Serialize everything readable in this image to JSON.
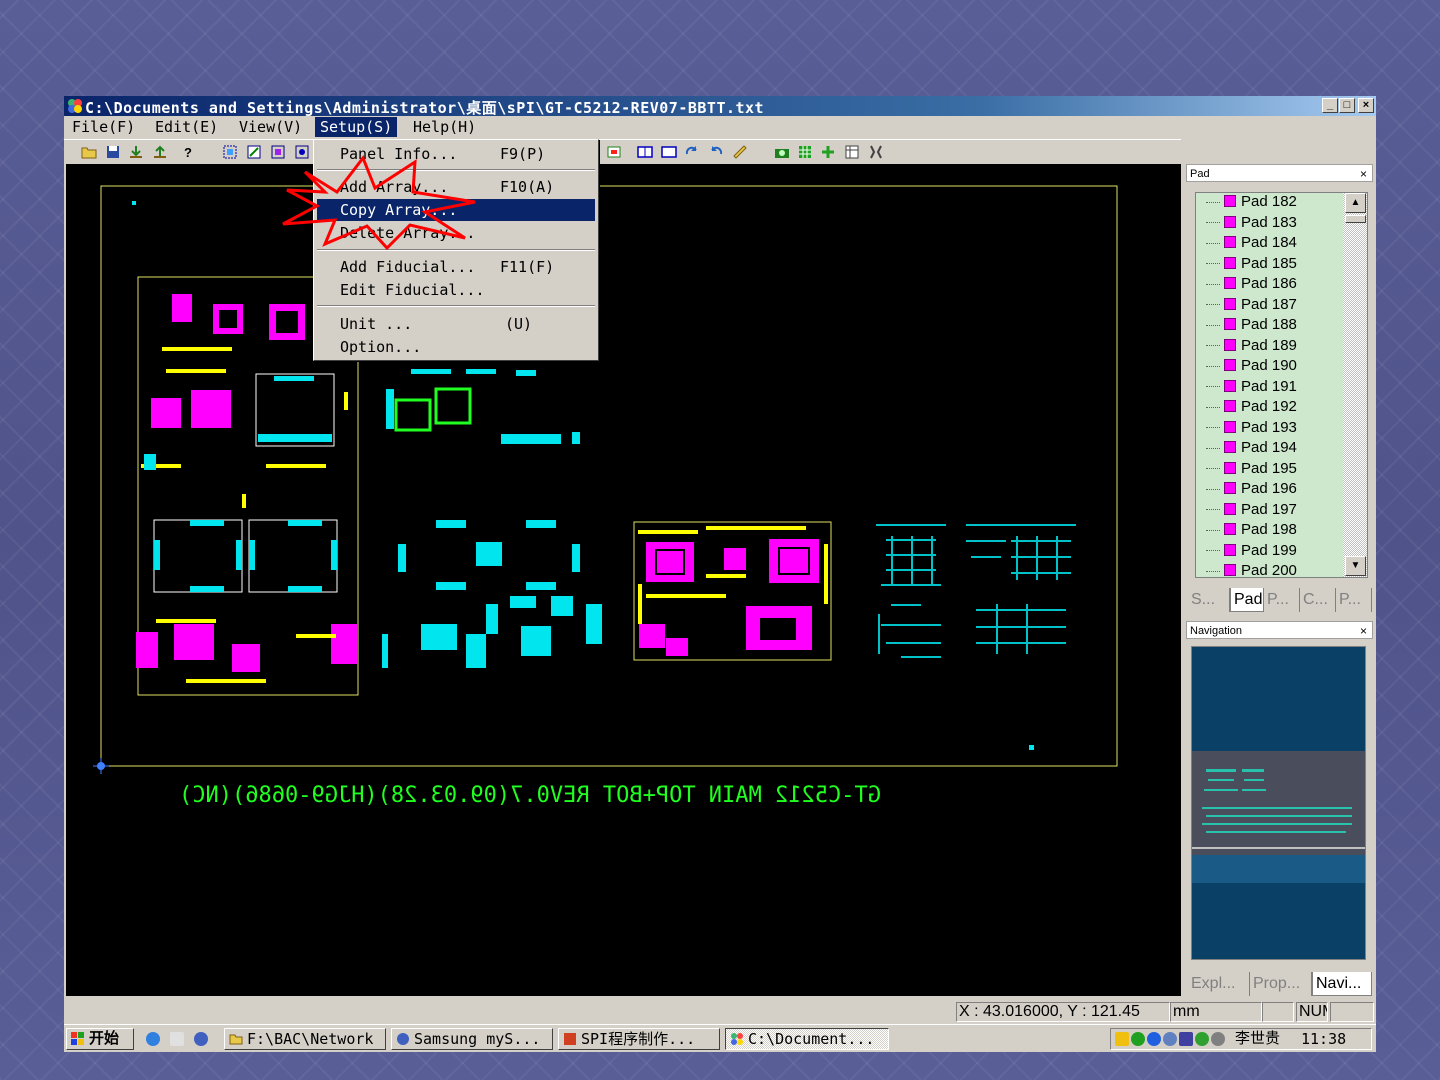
{
  "window": {
    "title": "C:\\Documents and Settings\\Administrator\\桌面\\sPI\\GT-C5212-REV07-BBTT.txt",
    "controls": {
      "minimize": "_",
      "maximize": "□",
      "close": "×"
    }
  },
  "menubar": {
    "file": "File(F)",
    "edit": "Edit(E)",
    "view": "View(V)",
    "setup": "Setup(S)",
    "help": "Help(H)"
  },
  "setup_menu": {
    "items": [
      {
        "label": "Panel Info...",
        "shortcut": "F9(P)"
      },
      {
        "label": "Add Array...",
        "shortcut": "F10(A)"
      },
      {
        "label": "Copy Array...",
        "shortcut": ""
      },
      {
        "label": "Delete Array...",
        "shortcut": ""
      },
      {
        "label": "Add Fiducial...",
        "shortcut": "F11(F)"
      },
      {
        "label": "Edit Fiducial...",
        "shortcut": ""
      },
      {
        "label": "Unit ...",
        "shortcut": "(U)"
      },
      {
        "label": "Option...",
        "shortcut": ""
      }
    ],
    "highlighted": "Copy Array..."
  },
  "canvas": {
    "board_label": "GT-C5212 MAIN TOP+BOT REV0.7(09.03.28)(HJG9-0686)(NC)"
  },
  "pad_panel": {
    "title": "Pad",
    "close": "×",
    "items": [
      "Pad 182",
      "Pad 183",
      "Pad 184",
      "Pad 185",
      "Pad 186",
      "Pad 187",
      "Pad 188",
      "Pad 189",
      "Pad 190",
      "Pad 191",
      "Pad 192",
      "Pad 193",
      "Pad 194",
      "Pad 195",
      "Pad 196",
      "Pad 197",
      "Pad 198",
      "Pad 199",
      "Pad 200"
    ],
    "tabs": [
      "S...",
      "Pad",
      "P...",
      "C...",
      "P..."
    ],
    "active_tab": "Pad"
  },
  "navigation_panel": {
    "title": "Navigation",
    "close": "×",
    "tabs": [
      "Expl...",
      "Prop...",
      "Navi..."
    ],
    "active_tab": "Navi..."
  },
  "statusbar": {
    "coords": "X : 43.016000, Y : 121.45",
    "unit": "mm",
    "num": "NUM"
  },
  "taskbar": {
    "start": "开始",
    "tasks": [
      "F:\\BAC\\Network",
      "Samsung myS...",
      "SPI程序制作...",
      "C:\\Document..."
    ],
    "active_task": "C:\\Document...",
    "user": "李世贵",
    "clock": "11:38"
  },
  "colors": {
    "pad_magenta": "#ff00ff",
    "pad_cyan": "#00e5ee",
    "board_outline": "#e0e060",
    "highlight": "#0a246a"
  }
}
